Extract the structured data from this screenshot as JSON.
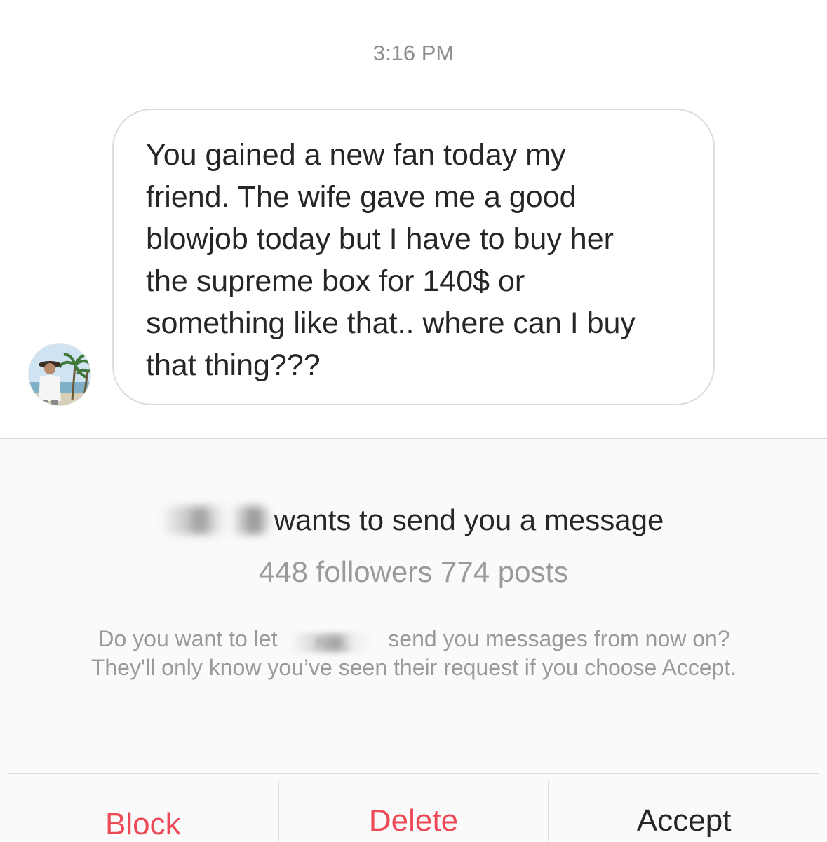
{
  "chat": {
    "timestamp": "3:16 PM",
    "message": "You gained a new fan today my\nfriend.  The wife gave me a good\nblowjob today but I have to buy her\nthe supreme box for 140$ or\nsomething like that.. where can I buy\nthat thing???"
  },
  "request": {
    "title_suffix": "wants to send you a message",
    "stats": "448 followers 774 posts",
    "desc_before": "Do you want to let",
    "desc_partial_name": "nie.",
    "desc_after": "send you messages from now on? They'll only know you’ve seen their request if you choose Accept."
  },
  "actions": {
    "block": "Block",
    "delete": "Delete",
    "accept": "Accept"
  },
  "colors": {
    "danger": "#ed4956",
    "text": "#262626",
    "muted": "#9a9a9a",
    "bubble_border": "#dcdcdc",
    "panel_bg": "#fafafa"
  }
}
